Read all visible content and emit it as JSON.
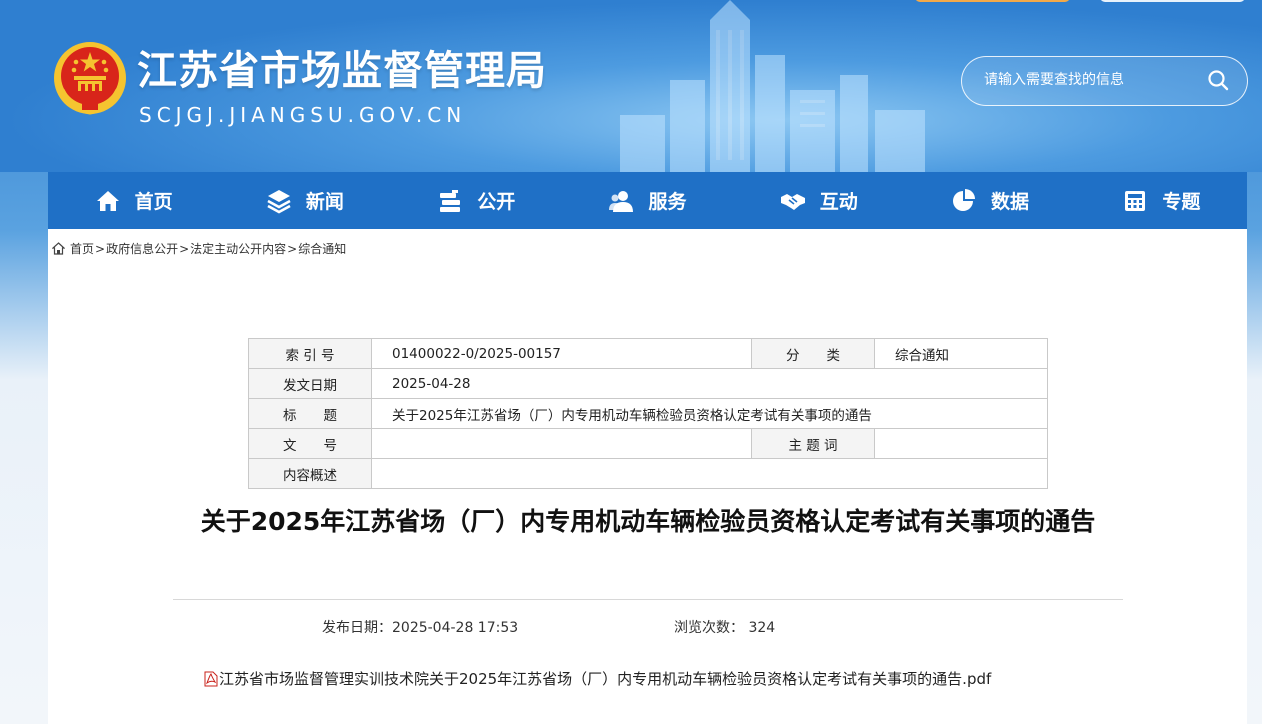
{
  "header": {
    "site_title": "江苏省市场监督管理局",
    "site_domain": "SCJGJ.JIANGSU.GOV.CN",
    "search_placeholder": "请输入需要查找的信息"
  },
  "nav": {
    "items": [
      {
        "label": "首页",
        "icon": "home-icon"
      },
      {
        "label": "新闻",
        "icon": "layers-icon"
      },
      {
        "label": "公开",
        "icon": "stack-icon"
      },
      {
        "label": "服务",
        "icon": "users-icon"
      },
      {
        "label": "互动",
        "icon": "handshake-icon"
      },
      {
        "label": "数据",
        "icon": "pie-chart-icon"
      },
      {
        "label": "专题",
        "icon": "calculator-icon"
      }
    ]
  },
  "breadcrumb": {
    "items": [
      "首页",
      "政府信息公开",
      "法定主动公开内容",
      "综合通知"
    ],
    "separator": ">"
  },
  "meta": {
    "index_label": "索 引 号",
    "index_value": "01400022-0/2025-00157",
    "category_label": "分　　类",
    "category_value": "综合通知",
    "date_label": "发文日期",
    "date_value": "2025-04-28",
    "title_label": "标　　题",
    "title_value": "关于2025年江苏省场（厂）内专用机动车辆检验员资格认定考试有关事项的通告",
    "docno_label": "文　　号",
    "docno_value": "",
    "keywords_label": "主 题 词",
    "keywords_value": "",
    "summary_label": "内容概述",
    "summary_value": ""
  },
  "article": {
    "title": "关于2025年江苏省场（厂）内专用机动车辆检验员资格认定考试有关事项的通告",
    "publish_label": "发布日期：",
    "publish_value": "2025-04-28 17:53",
    "views_label": "浏览次数：",
    "views_value": "324",
    "attachment": "江苏省市场监督管理实训技术院关于2025年江苏省场（厂）内专用机动车辆检验员资格认定考试有关事项的通告.pdf"
  },
  "colors": {
    "nav_bg": "#1f70c6",
    "header_bg": "#2f7fd0",
    "emblem_red": "#d8251a",
    "emblem_gold": "#f5c430"
  }
}
